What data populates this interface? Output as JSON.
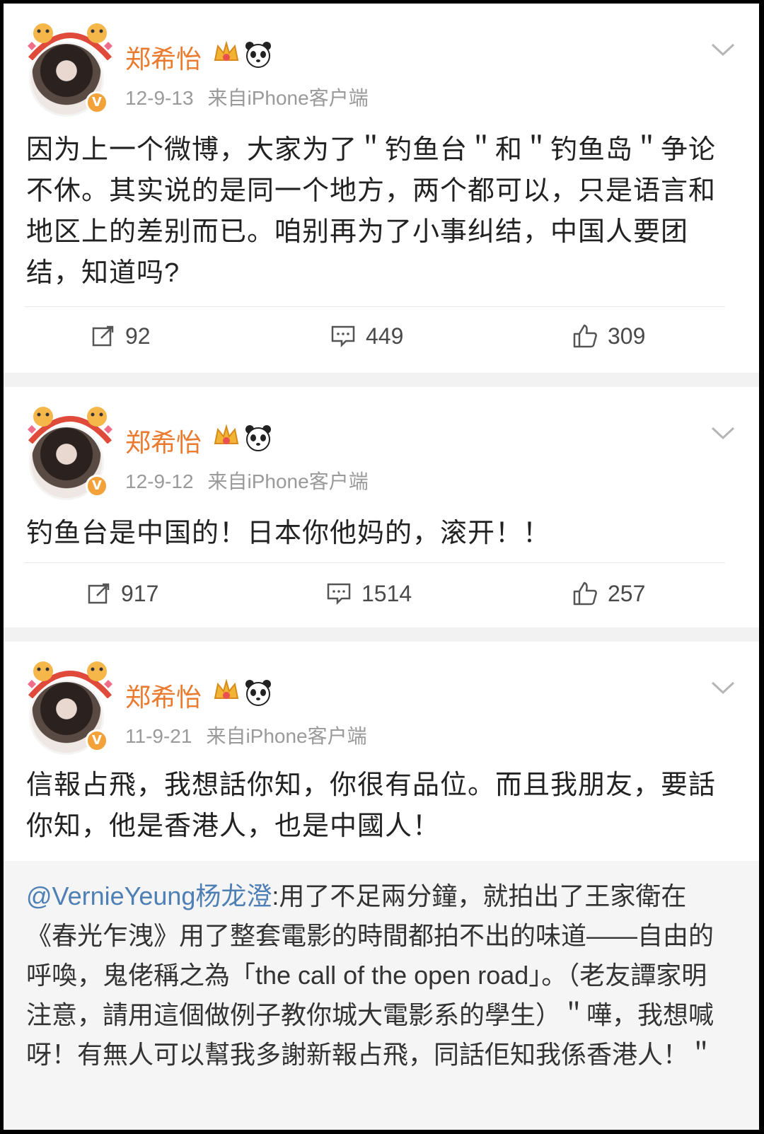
{
  "posts": [
    {
      "author": "郑希怡",
      "date": "12-9-13",
      "source": "来自iPhone客户端",
      "text": "因为上一个微博，大家为了＂钓鱼台＂和＂钓鱼岛＂争论不休。其实说的是同一个地方，两个都可以，只是语言和地区上的差别而已。咱别再为了小事纠结，中国人要团结，知道吗?",
      "reposts": "92",
      "comments": "449",
      "likes": "309"
    },
    {
      "author": "郑希怡",
      "date": "12-9-12",
      "source": "来自iPhone客户端",
      "text": "钓鱼台是中国的！日本你他妈的，滚开！！",
      "reposts": "917",
      "comments": "1514",
      "likes": "257"
    },
    {
      "author": "郑希怡",
      "date": "11-9-21",
      "source": "来自iPhone客户端",
      "text": "信報占飛，我想話你知，你很有品位。而且我朋友，要話你知，他是香港人，也是中國人！",
      "quote_author": "@VernieYeung杨龙澄",
      "quote_text": ":用了不足兩分鐘，就拍出了王家衛在《春光乍洩》用了整套電影的時間都拍不出的味道——自由的呼喚，鬼佬稱之為「the call of the open road」。（老友譚家明注意，請用這個做例子教你城大電影系的學生）＂嘩，我想喊呀！有無人可以幫我多謝新報占飛，同話佢知我係香港人！＂"
    }
  ],
  "colors": {
    "author": "#ea7a2d",
    "meta": "#9a9a9a",
    "mention": "#4e7fb5",
    "verified": "#f3a23a"
  },
  "icons": [
    "repost-icon",
    "comment-icon",
    "like-icon",
    "chevron-down-icon",
    "crown-icon",
    "panda-icon",
    "verified-icon"
  ]
}
